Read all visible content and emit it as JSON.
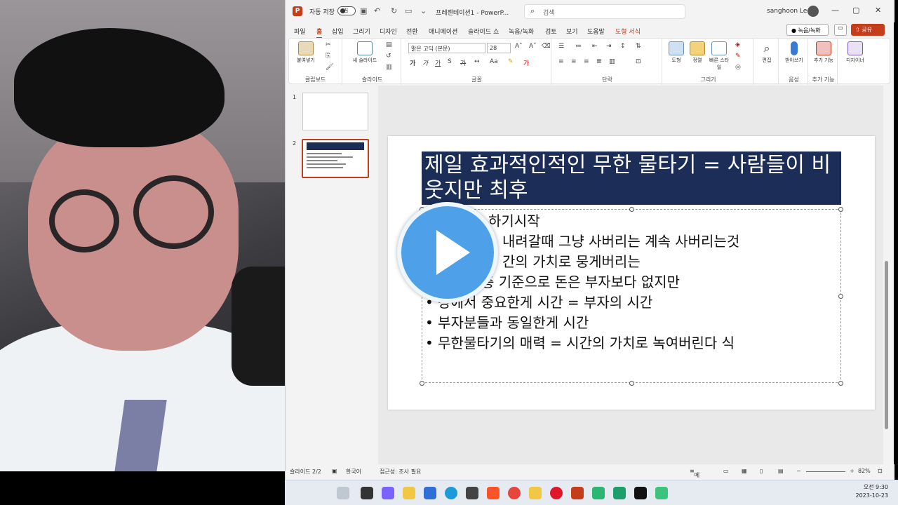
{
  "titlebar": {
    "autosave": "자동 저장",
    "toggle_state": "끔",
    "doc_title": "프레젠테이션1 - PowerP...",
    "search_placeholder": "검색",
    "user": "sanghoon Lee"
  },
  "menu": [
    "파일",
    "홈",
    "삽입",
    "그리기",
    "디자인",
    "전환",
    "애니메이션",
    "슬라이드 쇼",
    "녹음/녹화",
    "검토",
    "보기",
    "도움말",
    "도형 서식"
  ],
  "menu_active": "홈",
  "buttons": {
    "record": "녹음/녹화",
    "share": "공유"
  },
  "ribbon": {
    "paste": "붙여넣기",
    "new_slide": "새 슬라이드",
    "font_name": "맑은 고딕 (본문)",
    "font_size": "28",
    "shapes": "도형",
    "arrange": "정렬",
    "quick_styles": "빠른 스타일",
    "edit": "편집",
    "dictate": "받아쓰기",
    "addins": "추가 기능",
    "designer": "디자이너",
    "groups": [
      "클립보드",
      "슬라이드",
      "글꼴",
      "단락",
      "그리기",
      "음성",
      "추가 기능"
    ]
  },
  "thumbnails": [
    "1",
    "2"
  ],
  "slide": {
    "title": "제일 효과적인적인 무한 물타기 = 사람들이 비웃지만 최후",
    "bullets": [
      "하기시작",
      "내려갈때 그냥 사버리는 계속 사버리는것",
      "간의 가치로 뭉게버리는",
      "층 기준으로 돈은 부자보다 없지만",
      "상에서 중요한게 시간 = 부자의 시간",
      "부자분들과 동일한게 시간",
      "무한물타기의 매력 = 시간의 가치로 녹여버린다 식"
    ]
  },
  "status": {
    "slide_count": "슬라이드 2/2",
    "language": "한국어",
    "accessibility": "접근성: 조사 필요",
    "notes": "메모",
    "zoom": "82%"
  },
  "clock": {
    "time": "오전 9:30",
    "date": "2023-10-23"
  }
}
